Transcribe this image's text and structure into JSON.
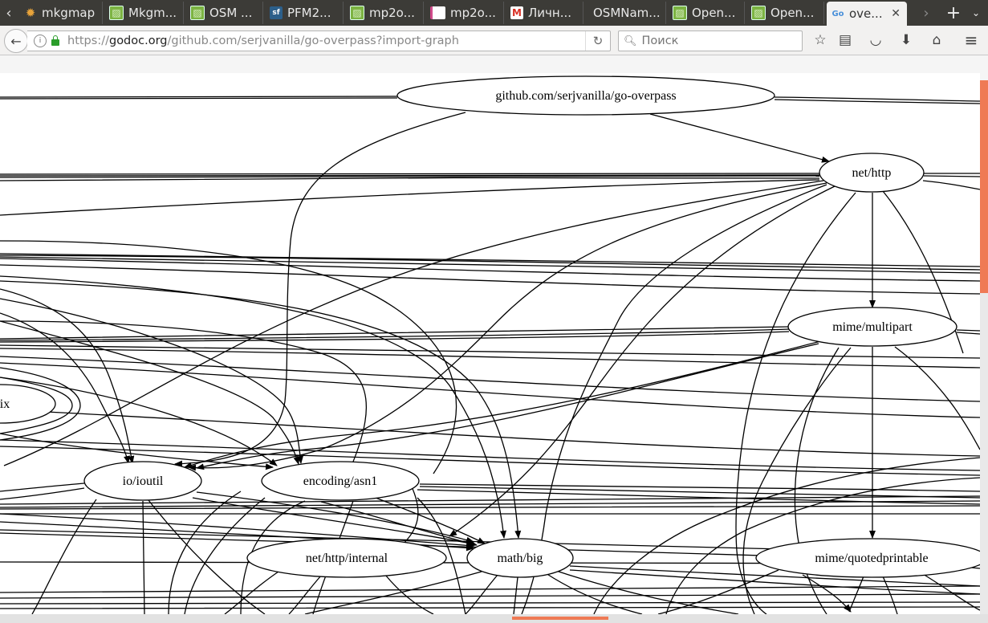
{
  "browser": {
    "tabs": [
      {
        "title": "mkgmap",
        "icon": "gear-icon",
        "color": "#e8a33a"
      },
      {
        "title": "Mkgm...",
        "icon": "map-icon",
        "color": "#7cb342"
      },
      {
        "title": "OSM ...",
        "icon": "map-icon",
        "color": "#7cb342"
      },
      {
        "title": "PFM2...",
        "icon": "sourceforge-icon",
        "color": "#2c5f8a"
      },
      {
        "title": "mp2o...",
        "icon": "map-icon",
        "color": "#7cb342"
      },
      {
        "title": "mp2o...",
        "icon": "page-icon",
        "color": "#d04a8a"
      },
      {
        "title": "Личн...",
        "icon": "mail-icon",
        "color": "#d93025"
      },
      {
        "title": "OSMNam...",
        "icon": "none",
        "color": ""
      },
      {
        "title": "Open...",
        "icon": "map-icon",
        "color": "#7cb342"
      },
      {
        "title": "Open...",
        "icon": "map-icon",
        "color": "#7cb342"
      },
      {
        "title": "ove...",
        "icon": "godoc-icon",
        "color": "#4a90d9",
        "active": true
      }
    ],
    "url_domain": "godoc.org",
    "url_scheme": "https://",
    "url_path": "/github.com/serjvanilla/go-overpass?import-graph",
    "search_placeholder": "Поиск"
  },
  "graph": {
    "nodes": [
      {
        "id": "root",
        "label": "github.com/serjvanilla/go-overpass"
      },
      {
        "id": "nethttp",
        "label": "net/http"
      },
      {
        "id": "multipart",
        "label": "mime/multipart"
      },
      {
        "id": "ix",
        "label": "ix"
      },
      {
        "id": "ioutil",
        "label": "io/ioutil"
      },
      {
        "id": "asn1",
        "label": "encoding/asn1"
      },
      {
        "id": "internal",
        "label": "net/http/internal"
      },
      {
        "id": "big",
        "label": "math/big"
      },
      {
        "id": "qp",
        "label": "mime/quotedprintable"
      }
    ]
  },
  "colors": {
    "accent": "#ef7a55",
    "tabbar": "#3c3b37"
  }
}
